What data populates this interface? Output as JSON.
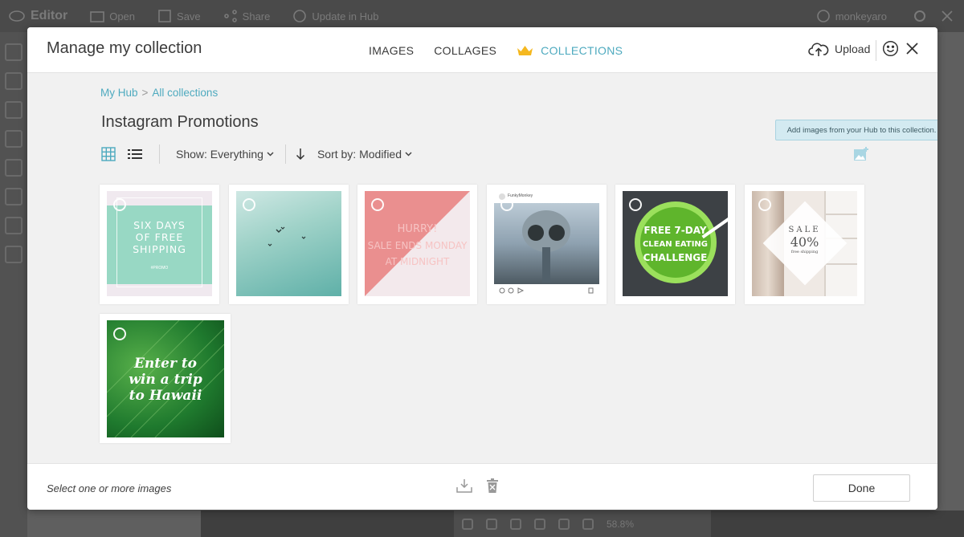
{
  "background": {
    "app_name": "Editor",
    "open_label": "Open",
    "save_label": "Save",
    "share_label": "Share",
    "update_label": "Update in Hub",
    "user_label": "monkeyaro",
    "zoom_label": "58.8%"
  },
  "modal": {
    "title": "Manage my collection",
    "tabs": [
      {
        "label": "IMAGES",
        "active": false
      },
      {
        "label": "COLLAGES",
        "active": false
      },
      {
        "label": "COLLECTIONS",
        "active": true
      }
    ],
    "upload_label": "Upload",
    "accent_color": "#4eaabf"
  },
  "breadcrumb": {
    "root": "My Hub",
    "separator": ">",
    "current": "All collections"
  },
  "collection": {
    "title": "Instagram Promotions",
    "show_label": "Show: Everything",
    "sort_label": "Sort by: Modified",
    "tooltip": "Add images from your Hub to this collection."
  },
  "images": [
    {
      "name": "six-days-free-shipping",
      "text_lines": [
        "SIX DAYS",
        "OF FREE",
        "SHIPPING"
      ],
      "tag": "#PROMO"
    },
    {
      "name": "birds-in-sky",
      "text_lines": []
    },
    {
      "name": "hurry-sale",
      "text_lines": [
        "HURRY!",
        "SALE ENDS MONDAY",
        "AT MIDNIGHT"
      ]
    },
    {
      "name": "binocular-post",
      "account": "FunkyMonkey",
      "text_lines": []
    },
    {
      "name": "green-smoothie",
      "text_lines": [
        "FREE 7-DAY",
        "CLEAN EATING",
        "CHALLENGE"
      ]
    },
    {
      "name": "closet-sale",
      "text_lines": [
        "SALE",
        "40%",
        "free shipping"
      ]
    },
    {
      "name": "hawaii-leaf",
      "text_lines": [
        "Enter to",
        "win a trip",
        "to Hawaii"
      ]
    }
  ],
  "footer": {
    "hint": "Select one or more images",
    "done_label": "Done"
  }
}
